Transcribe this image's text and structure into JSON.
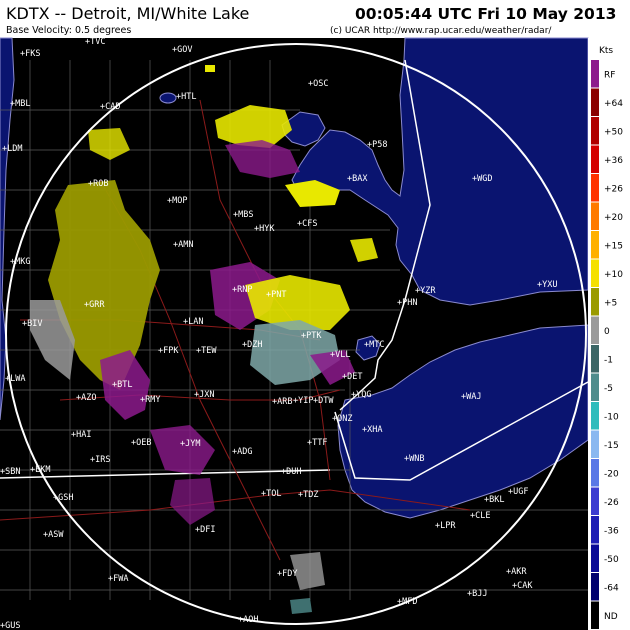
{
  "header": {
    "station": "KDTX -- Detroit, MI/White Lake",
    "product": "Base Velocity: 0.5 degrees",
    "datetime": "00:05:44 UTC Fri 10 May 2013",
    "credit": "(c) UCAR  http://www.rap.ucar.edu/weather/radar/"
  },
  "legend": {
    "units": "Kts",
    "levels": [
      {
        "label": "RF",
        "color": "#8c1a8c"
      },
      {
        "label": "+64",
        "color": "#8b0000"
      },
      {
        "label": "+50",
        "color": "#b00000"
      },
      {
        "label": "+36",
        "color": "#d40000"
      },
      {
        "label": "+26",
        "color": "#ff3300"
      },
      {
        "label": "+20",
        "color": "#ff7a00"
      },
      {
        "label": "+15",
        "color": "#ffb000"
      },
      {
        "label": "+10",
        "color": "#f5e000"
      },
      {
        "label": "+5",
        "color": "#9a9a00"
      },
      {
        "label": "0",
        "color": "#9a9a9a"
      },
      {
        "label": "-1",
        "color": "#3c6666"
      },
      {
        "label": "-5",
        "color": "#4f8c8c"
      },
      {
        "label": "-10",
        "color": "#2fbcbc"
      },
      {
        "label": "-15",
        "color": "#8ab8f0"
      },
      {
        "label": "-20",
        "color": "#5a78e6"
      },
      {
        "label": "-26",
        "color": "#3c3cd0"
      },
      {
        "label": "-36",
        "color": "#1e1eb4"
      },
      {
        "label": "-50",
        "color": "#0a0a96"
      },
      {
        "label": "-64",
        "color": "#00006e"
      },
      {
        "label": "ND",
        "color": "#000000"
      }
    ]
  },
  "colors": {
    "header_bg": "#ffffff",
    "land": "#000000",
    "water": "#0a1470",
    "shore": "#8a8acf",
    "range_ring": "#ffffff",
    "county_lines": "#5a5a5a",
    "state_lines": "#ffffff",
    "roads": "#8b1a1a"
  },
  "cities": [
    {
      "label": "FKS"
    },
    {
      "label": "TVC"
    },
    {
      "label": "GOV"
    },
    {
      "label": "HTL"
    },
    {
      "label": "OSC"
    },
    {
      "label": "MBL"
    },
    {
      "label": "CAD"
    },
    {
      "label": "LDM"
    },
    {
      "label": "P58"
    },
    {
      "label": "ROB"
    },
    {
      "label": "BAX"
    },
    {
      "label": "WGD"
    },
    {
      "label": "MOP"
    },
    {
      "label": "MBS"
    },
    {
      "label": "CFS"
    },
    {
      "label": "HYK"
    },
    {
      "label": "AMN"
    },
    {
      "label": "MKG"
    },
    {
      "label": "YZR"
    },
    {
      "label": "YXU"
    },
    {
      "label": "RNP"
    },
    {
      "label": "PNT"
    },
    {
      "label": "PHN"
    },
    {
      "label": "GRR"
    },
    {
      "label": "BIV"
    },
    {
      "label": "LAN"
    },
    {
      "label": "FPK"
    },
    {
      "label": "TEW"
    },
    {
      "label": "DZH"
    },
    {
      "label": "MTC"
    },
    {
      "label": "PTK"
    },
    {
      "label": "VLL"
    },
    {
      "label": "LWA"
    },
    {
      "label": "BTL"
    },
    {
      "label": "DET"
    },
    {
      "label": "AZO"
    },
    {
      "label": "RMY"
    },
    {
      "label": "JXN"
    },
    {
      "label": "ARB"
    },
    {
      "label": "YIP"
    },
    {
      "label": "DTW"
    },
    {
      "label": "YQG"
    },
    {
      "label": "WAJ"
    },
    {
      "label": "ONZ"
    },
    {
      "label": "XHA"
    },
    {
      "label": "HAI"
    },
    {
      "label": "OEB"
    },
    {
      "label": "JYM"
    },
    {
      "label": "TTF"
    },
    {
      "label": "ADG"
    },
    {
      "label": "WNB"
    },
    {
      "label": "IRS"
    },
    {
      "label": "SBN"
    },
    {
      "label": "EKM"
    },
    {
      "label": "DUH"
    },
    {
      "label": "GSH"
    },
    {
      "label": "TOL"
    },
    {
      "label": "TDZ"
    },
    {
      "label": "BKL"
    },
    {
      "label": "UGF"
    },
    {
      "label": "LPR"
    },
    {
      "label": "CLE"
    },
    {
      "label": "DFI"
    },
    {
      "label": "ASW"
    },
    {
      "label": "AKR"
    },
    {
      "label": "FDY"
    },
    {
      "label": "CAK"
    },
    {
      "label": "FWA"
    },
    {
      "label": "BJJ"
    },
    {
      "label": "MFD"
    },
    {
      "label": "AOH"
    },
    {
      "label": "GUS"
    }
  ]
}
